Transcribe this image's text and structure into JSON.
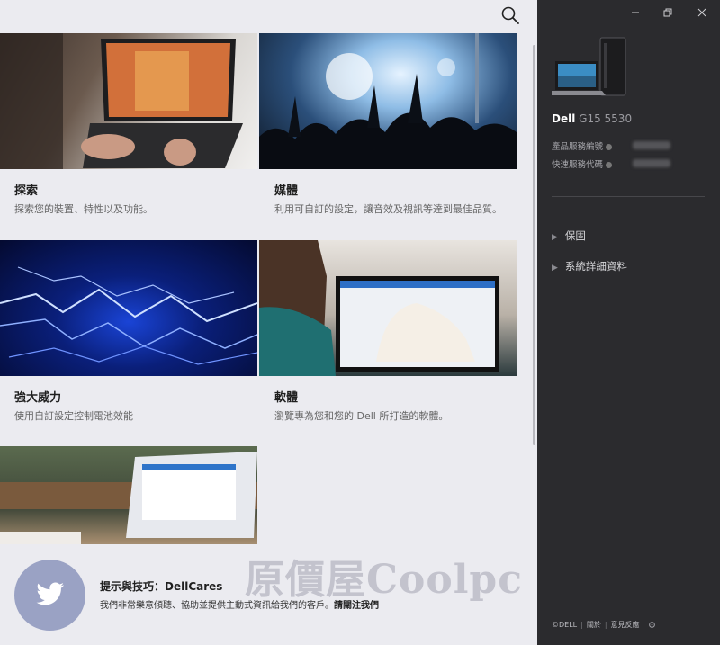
{
  "window": {
    "controls": [
      "minimize-icon",
      "restore-icon",
      "close-icon"
    ]
  },
  "main": {
    "cards": [
      {
        "title": "探索",
        "desc": "探索您的裝置、特性以及功能。"
      },
      {
        "title": "媒體",
        "desc": "利用可自訂的設定，讓音效及視訊等達到最佳品質。"
      },
      {
        "title": "強大威力",
        "desc": "使用自訂設定控制電池效能"
      },
      {
        "title": "軟體",
        "desc": "瀏覽專為您和您的 Dell 所打造的軟體。"
      }
    ]
  },
  "tips": {
    "title": "提示與技巧：DellCares",
    "text": "我們非常樂意傾聽、協助並提供主動式資訊給我們的客戶。",
    "follow": "請關注我們",
    "watermark": "原價屋Coolpc"
  },
  "sidebar": {
    "brand": "Dell",
    "model": "G15 5530",
    "service_tag_label": "產品服務編號",
    "express_code_label": "快速服務代碼",
    "links": [
      {
        "label": "保固"
      },
      {
        "label": "系統詳細資料"
      }
    ],
    "footer": {
      "copyright": "©DELL",
      "about": "關於",
      "feedback": "意見反應"
    }
  },
  "colors": {
    "sidebar_bg": "#2b2b2e",
    "main_bg": "#ebebf0",
    "twitter_circle": "#9aa2c4"
  }
}
